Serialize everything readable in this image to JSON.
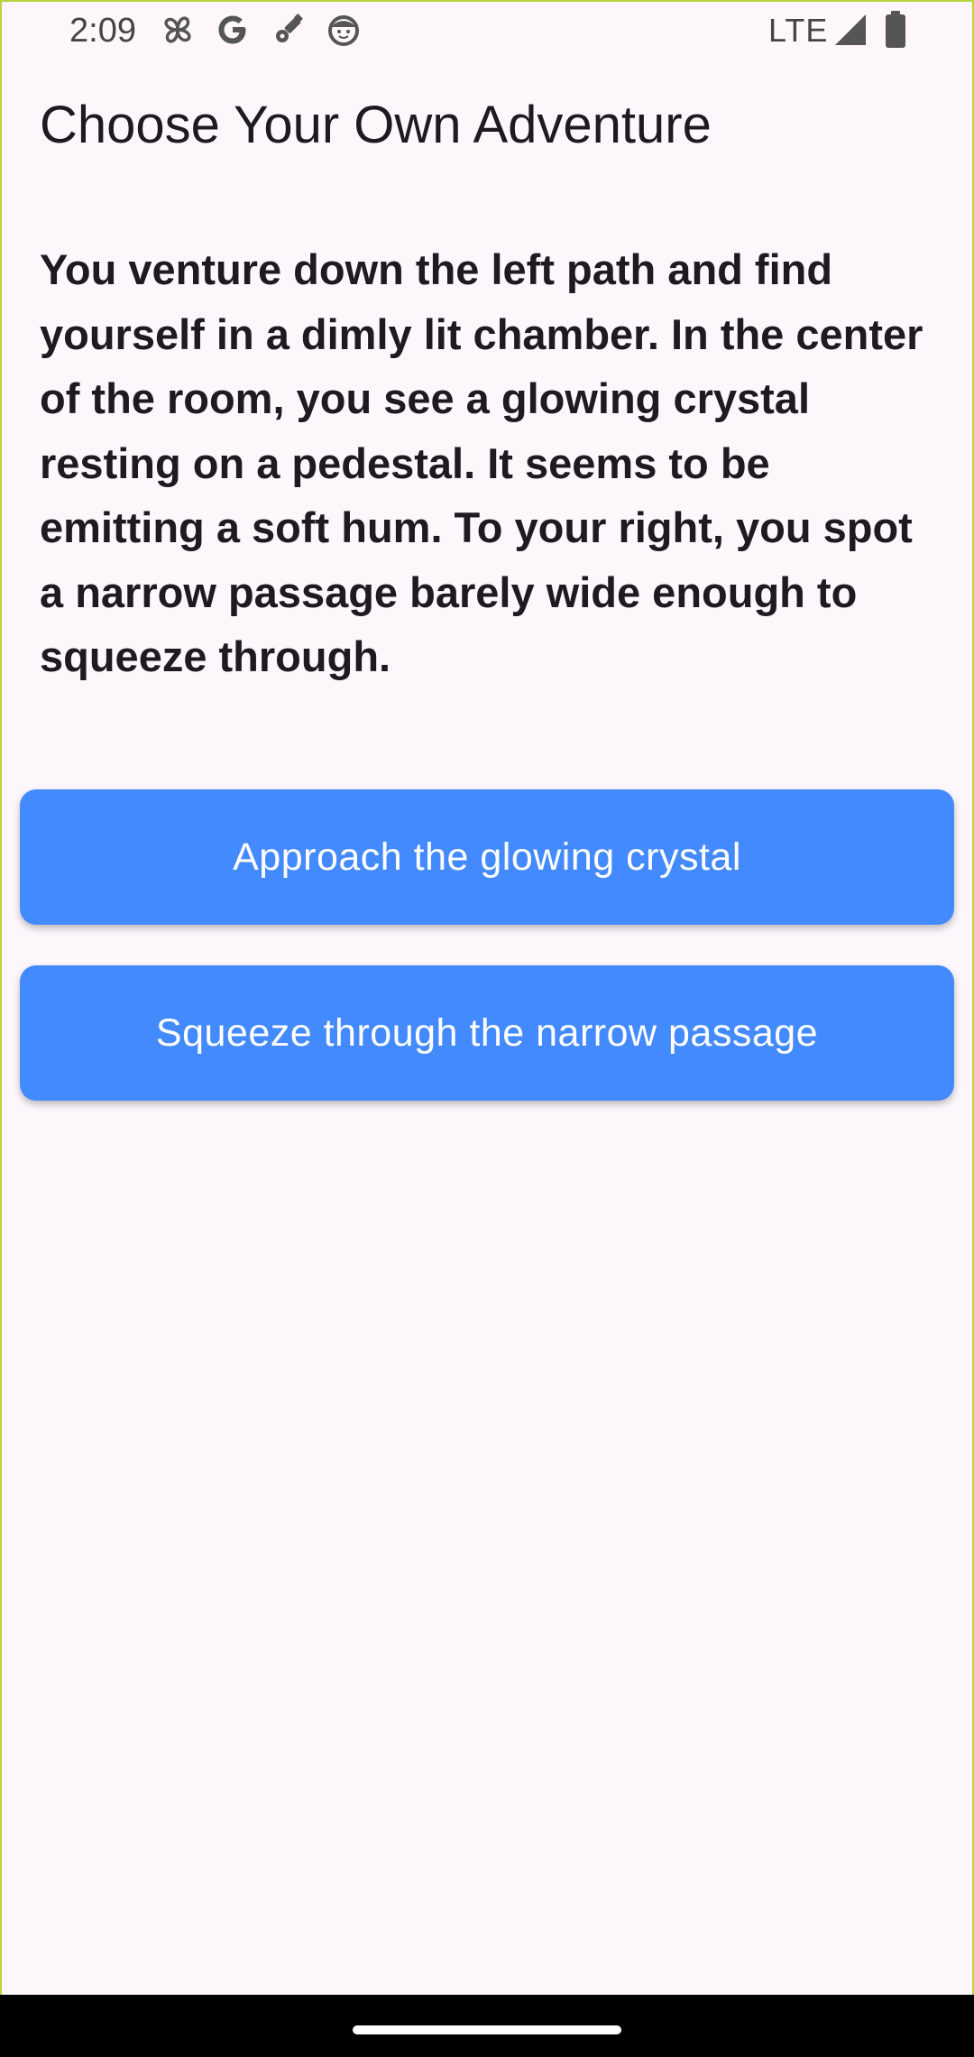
{
  "status_bar": {
    "time": "2:09",
    "network": "LTE",
    "icons": [
      "pinwheel-icon",
      "google-icon",
      "satellite-icon",
      "face-icon",
      "signal-icon",
      "battery-icon"
    ]
  },
  "app": {
    "title": "Choose Your Own Adventure"
  },
  "story": {
    "text": "You venture down the left path and find yourself in a dimly lit chamber. In the center of the room, you see a glowing crystal resting on a pedestal. It seems to be emitting a soft hum. To your right, you spot a narrow passage barely wide enough to squeeze through."
  },
  "choices": [
    {
      "label": "Approach the glowing crystal"
    },
    {
      "label": "Squeeze through the narrow passage"
    }
  ],
  "colors": {
    "background": "#fdf7fc",
    "button": "#448aff",
    "button_text": "#ffffff",
    "text": "#1d1b20",
    "frame_border": "#b7d53a"
  }
}
